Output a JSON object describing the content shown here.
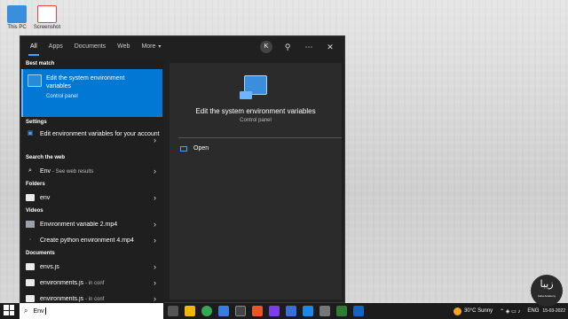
{
  "desktop_icons": [
    {
      "label": "This PC",
      "color": "#3a8fdc"
    },
    {
      "label": "Screenshot",
      "color": "#e24a4a"
    }
  ],
  "tabs": [
    "All",
    "Apps",
    "Documents",
    "Web",
    "More"
  ],
  "more_chevron": "▾",
  "avatar_initial": "K",
  "best_match": {
    "section": "Best match",
    "title": "Edit the system environment variables",
    "subtitle": "Control panel"
  },
  "settings": {
    "section": "Settings",
    "item": "Edit environment variables for your account"
  },
  "web": {
    "section": "Search the web",
    "query": "Env",
    "suffix": "- See web results"
  },
  "folders": {
    "section": "Folders",
    "item": "env"
  },
  "videos": {
    "section": "Videos",
    "items": [
      "Environment variable 2.mp4",
      "Create python environment 4.mp4"
    ]
  },
  "documents": {
    "section": "Documents",
    "items": [
      {
        "name": "envs.js",
        "sub": ""
      },
      {
        "name": "environments.js",
        "sub": "- in conf"
      },
      {
        "name": "environments.js",
        "sub": "- in conf"
      }
    ]
  },
  "preview": {
    "title": "Edit the system environment variables",
    "subtitle": "Control panel",
    "action": "Open"
  },
  "taskbar": {
    "search_value": "Env",
    "weather": "30°C  Sunny",
    "lang": "ENG",
    "date": "15-03-2022"
  },
  "watermark": {
    "text": "زیبا",
    "sub": "Zeba Academy"
  },
  "colors": {
    "accent": "#0078d4",
    "panel": "#202020"
  }
}
